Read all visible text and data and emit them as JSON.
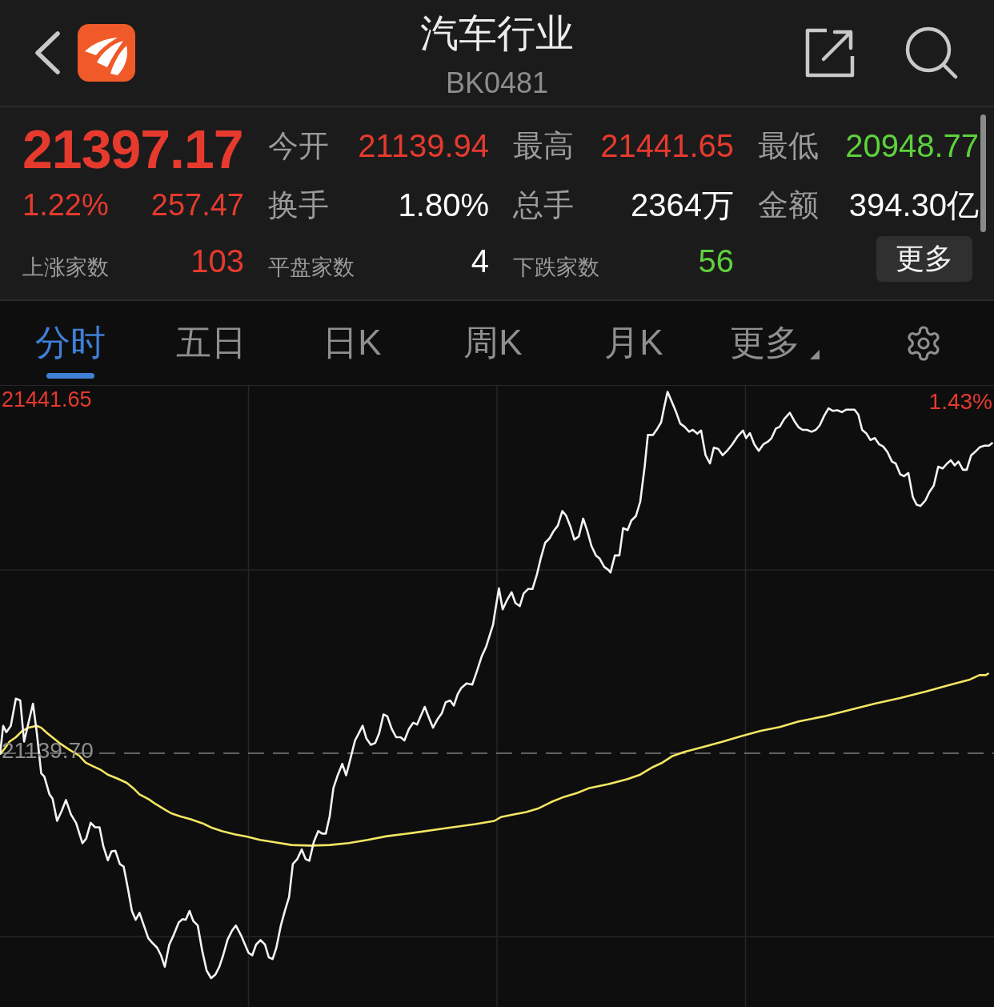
{
  "header": {
    "title": "汽车行业",
    "code": "BK0481"
  },
  "quote": {
    "price": "21397.17",
    "change_percent": "1.22%",
    "change": "257.47"
  },
  "stats": [
    {
      "label": "今开",
      "value": "21139.94",
      "color": "#e63a2e"
    },
    {
      "label": "最高",
      "value": "21441.65",
      "color": "#e63a2e"
    },
    {
      "label": "最低",
      "value": "20948.77",
      "color": "#5ed13c"
    },
    {
      "label": "换手",
      "value": "1.80%",
      "color": "#ffffff"
    },
    {
      "label": "总手",
      "value": "2364万",
      "color": "#ffffff"
    },
    {
      "label": "金额",
      "value": "394.30亿",
      "color": "#ffffff"
    }
  ],
  "breadth": [
    {
      "label": "上涨家数",
      "value": "103",
      "color": "#e63a2e"
    },
    {
      "label": "平盘家数",
      "value": "4",
      "color": "#ffffff"
    },
    {
      "label": "下跌家数",
      "value": "56",
      "color": "#5ed13c"
    }
  ],
  "more_button": {
    "label": "更多"
  },
  "tabs": [
    {
      "label": "分时",
      "selected": true,
      "kind": "tab"
    },
    {
      "label": "五日",
      "selected": false,
      "kind": "tab"
    },
    {
      "label": "日K",
      "selected": false,
      "kind": "tab"
    },
    {
      "label": "周K",
      "selected": false,
      "kind": "tab"
    },
    {
      "label": "月K",
      "selected": false,
      "kind": "tab"
    },
    {
      "label": "更多",
      "selected": false,
      "kind": "menu"
    }
  ],
  "chart": {
    "high_label": "21441.65",
    "high_percent_label": "1.43%",
    "base_label": "21139.70"
  }
}
